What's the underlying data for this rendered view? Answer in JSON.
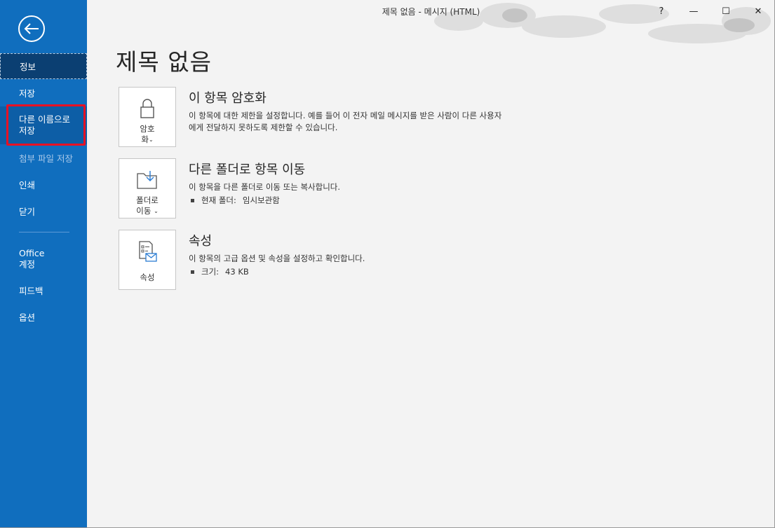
{
  "window": {
    "title": "제목 없음  -  메시지 (HTML)",
    "help": "?",
    "minimize": "—",
    "maximize": "☐",
    "close": "✕"
  },
  "sidebar": {
    "back_icon": "back-arrow-icon",
    "items": [
      {
        "label": "정보",
        "state": "active"
      },
      {
        "label": "저장",
        "state": "normal"
      },
      {
        "label": "다른 이름으로 저장",
        "state": "hover",
        "highlighted": true
      },
      {
        "label": "첨부 파일 저장",
        "state": "disabled"
      },
      {
        "label": "인쇄",
        "state": "normal"
      },
      {
        "label": "닫기",
        "state": "normal"
      },
      {
        "label": "Office 계정",
        "state": "normal"
      },
      {
        "label": "피드백",
        "state": "normal"
      },
      {
        "label": "옵션",
        "state": "normal"
      }
    ]
  },
  "main": {
    "title": "제목 없음",
    "sections": [
      {
        "tile_line1": "암호",
        "tile_line2": "화",
        "tile_icon": "lock-icon",
        "heading": "이 항목 암호화",
        "description": "이 항목에 대한 제한을 설정합니다. 예를 들어 이 전자 메일 메시지를 받은 사람이 다른 사용자에게 전달하지 못하도록 제한할 수 있습니다."
      },
      {
        "tile_line1": "폴더로",
        "tile_line2": "이동",
        "tile_icon": "move-to-folder-icon",
        "heading": "다른 폴더로 항목 이동",
        "description": "이 항목을 다른 폴더로 이동 또는 복사합니다.",
        "bullet_label": "현재 폴더:",
        "bullet_value": "임시보관함"
      },
      {
        "tile_line1": "속성",
        "tile_icon": "properties-icon",
        "heading": "속성",
        "description": "이 항목의 고급 옵션 및 속성을 설정하고 확인합니다.",
        "bullet_label": "크기:",
        "bullet_value": "43 KB"
      }
    ]
  },
  "colors": {
    "sidebar": "#106ebe",
    "sidebar_active": "#0b3f72",
    "highlight": "#e81123",
    "background": "#f3f3f3"
  }
}
